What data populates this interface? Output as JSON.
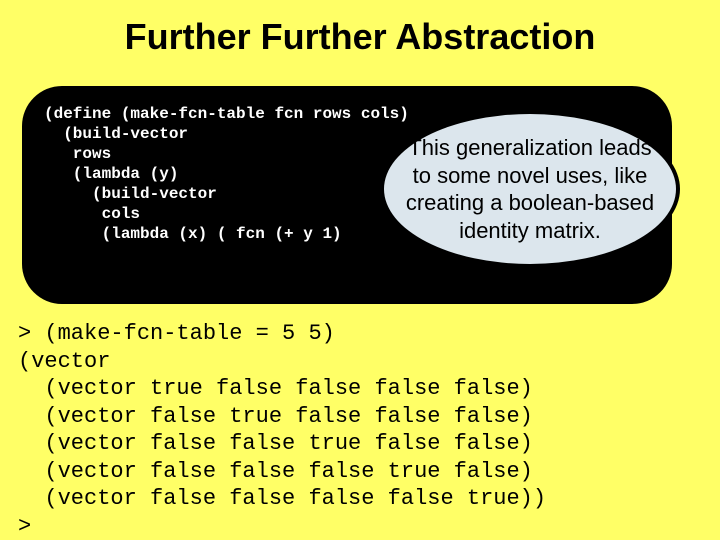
{
  "title": "Further Further Abstraction",
  "code": {
    "l1": "(define (make-fcn-table fcn rows cols)",
    "l2": "  (build-vector",
    "l3": "   rows",
    "l4": "   (lambda (y)",
    "l5": "     (build-vector",
    "l6": "      cols",
    "l7": "      (lambda (x) ( fcn (+ y 1)"
  },
  "callout": "This generalization leads to some novel uses, like creating a boolean-based identity matrix.",
  "output": {
    "l1": "> (make-fcn-table = 5 5)",
    "l2": "(vector",
    "l3": "  (vector true false false false false)",
    "l4": "  (vector false true false false false)",
    "l5": "  (vector false false true false false)",
    "l6": "  (vector false false false true false)",
    "l7": "  (vector false false false false true))",
    "l8": ">"
  }
}
